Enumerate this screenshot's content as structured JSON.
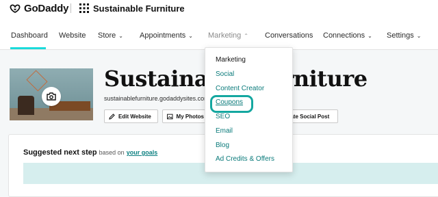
{
  "brand": {
    "name": "GoDaddy"
  },
  "site": {
    "name": "Sustainable Furniture",
    "title": "Sustainable Furniture",
    "url": "sustainablefurniture.godaddysites.com"
  },
  "nav": {
    "items": [
      {
        "label": "Dashboard",
        "has_dropdown": false
      },
      {
        "label": "Website",
        "has_dropdown": false
      },
      {
        "label": "Store",
        "has_dropdown": true
      },
      {
        "label": "Appointments",
        "has_dropdown": true
      },
      {
        "label": "Marketing",
        "has_dropdown": true
      },
      {
        "label": "Conversations",
        "has_dropdown": false
      },
      {
        "label": "Connections",
        "has_dropdown": true
      },
      {
        "label": "Settings",
        "has_dropdown": true
      }
    ],
    "chevron_down": "⌄",
    "chevron_up": "⌃"
  },
  "actions": {
    "edit_website": "Edit Website",
    "my_photos": "My Photos",
    "create_social_post": "Create Social Post"
  },
  "marketing_menu": {
    "heading": "Marketing",
    "items": [
      "Social",
      "Content Creator",
      "Coupons",
      "SEO",
      "Email",
      "Blog",
      "Ad Credits & Offers"
    ]
  },
  "suggested": {
    "title": "Suggested next step",
    "sub": "based on",
    "link": "your goals"
  },
  "colors": {
    "accent_teal": "#1bdbdb",
    "link_teal": "#097a7a",
    "highlight_ring": "#14a7a0"
  }
}
